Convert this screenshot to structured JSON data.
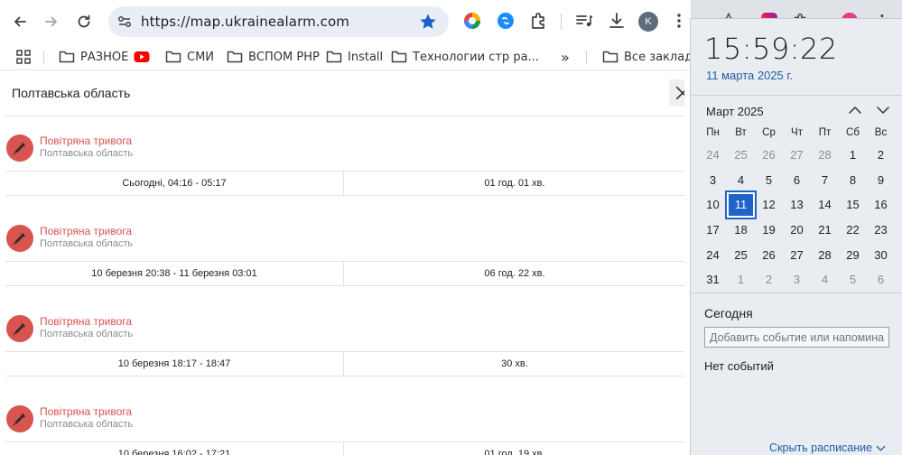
{
  "browser": {
    "url": "https://map.ukrainealarm.com",
    "avatar_letter": "K",
    "accent": "#1a73e8"
  },
  "bookmarks": {
    "items": [
      {
        "label": "РАЗНОЕ",
        "icon": "folder-icon"
      },
      {
        "label": "",
        "icon": "youtube-icon"
      },
      {
        "label": "СМИ",
        "icon": "folder-icon"
      },
      {
        "label": "ВСПОМ РНР",
        "icon": "folder-icon"
      },
      {
        "label": "Install",
        "icon": "folder-icon"
      },
      {
        "label": "Технологии стр ра...",
        "icon": "folder-icon"
      }
    ],
    "overflow": "»",
    "all_label": "Все закладки"
  },
  "page": {
    "title": "Полтавська область",
    "alerts": [
      {
        "type": "Повітряна тривога",
        "region": "Полтавська область",
        "period": "Сьогодні, 04:16 - 05:17",
        "duration": "01 год. 01 хв."
      },
      {
        "type": "Повітряна тривога",
        "region": "Полтавська область",
        "period": "10 березня 20:38 - 11 березня 03:01",
        "duration": "06 год. 22 хв."
      },
      {
        "type": "Повітряна тривога",
        "region": "Полтавська область",
        "period": "10 березня 18:17 - 18:47",
        "duration": "30 хв."
      },
      {
        "type": "Повітряна тривога",
        "region": "Полтавська область",
        "period": "10 березня 16:02 - 17:21",
        "duration": "01 год. 19 хв."
      }
    ],
    "alert_color": "#d9534f"
  },
  "calendar": {
    "time": "15:59:22",
    "date": "11 марта 2025 г.",
    "month": "Март 2025",
    "weekdays": [
      "Пн",
      "Вт",
      "Ср",
      "Чт",
      "Пт",
      "Сб",
      "Вс"
    ],
    "weeks": [
      [
        {
          "d": "24",
          "m": true
        },
        {
          "d": "25",
          "m": true
        },
        {
          "d": "26",
          "m": true
        },
        {
          "d": "27",
          "m": true
        },
        {
          "d": "28",
          "m": true
        },
        {
          "d": "1"
        },
        {
          "d": "2"
        }
      ],
      [
        {
          "d": "3"
        },
        {
          "d": "4"
        },
        {
          "d": "5"
        },
        {
          "d": "6"
        },
        {
          "d": "7"
        },
        {
          "d": "8"
        },
        {
          "d": "9"
        }
      ],
      [
        {
          "d": "10"
        },
        {
          "d": "11",
          "today": true
        },
        {
          "d": "12"
        },
        {
          "d": "13"
        },
        {
          "d": "14"
        },
        {
          "d": "15"
        },
        {
          "d": "16"
        }
      ],
      [
        {
          "d": "17"
        },
        {
          "d": "18"
        },
        {
          "d": "19"
        },
        {
          "d": "20"
        },
        {
          "d": "21"
        },
        {
          "d": "22"
        },
        {
          "d": "23"
        }
      ],
      [
        {
          "d": "24"
        },
        {
          "d": "25"
        },
        {
          "d": "26"
        },
        {
          "d": "27"
        },
        {
          "d": "28"
        },
        {
          "d": "29"
        },
        {
          "d": "30"
        }
      ],
      [
        {
          "d": "31"
        },
        {
          "d": "1",
          "m": true
        },
        {
          "d": "2",
          "m": true
        },
        {
          "d": "3",
          "m": true
        },
        {
          "d": "4",
          "m": true
        },
        {
          "d": "5",
          "m": true
        },
        {
          "d": "6",
          "m": true
        }
      ]
    ],
    "today_label": "Сегодня",
    "event_placeholder": "Добавить событие или напомина",
    "no_events": "Нет событий",
    "hide_schedule": "Скрыть расписание",
    "accent": "#1e63c6"
  }
}
